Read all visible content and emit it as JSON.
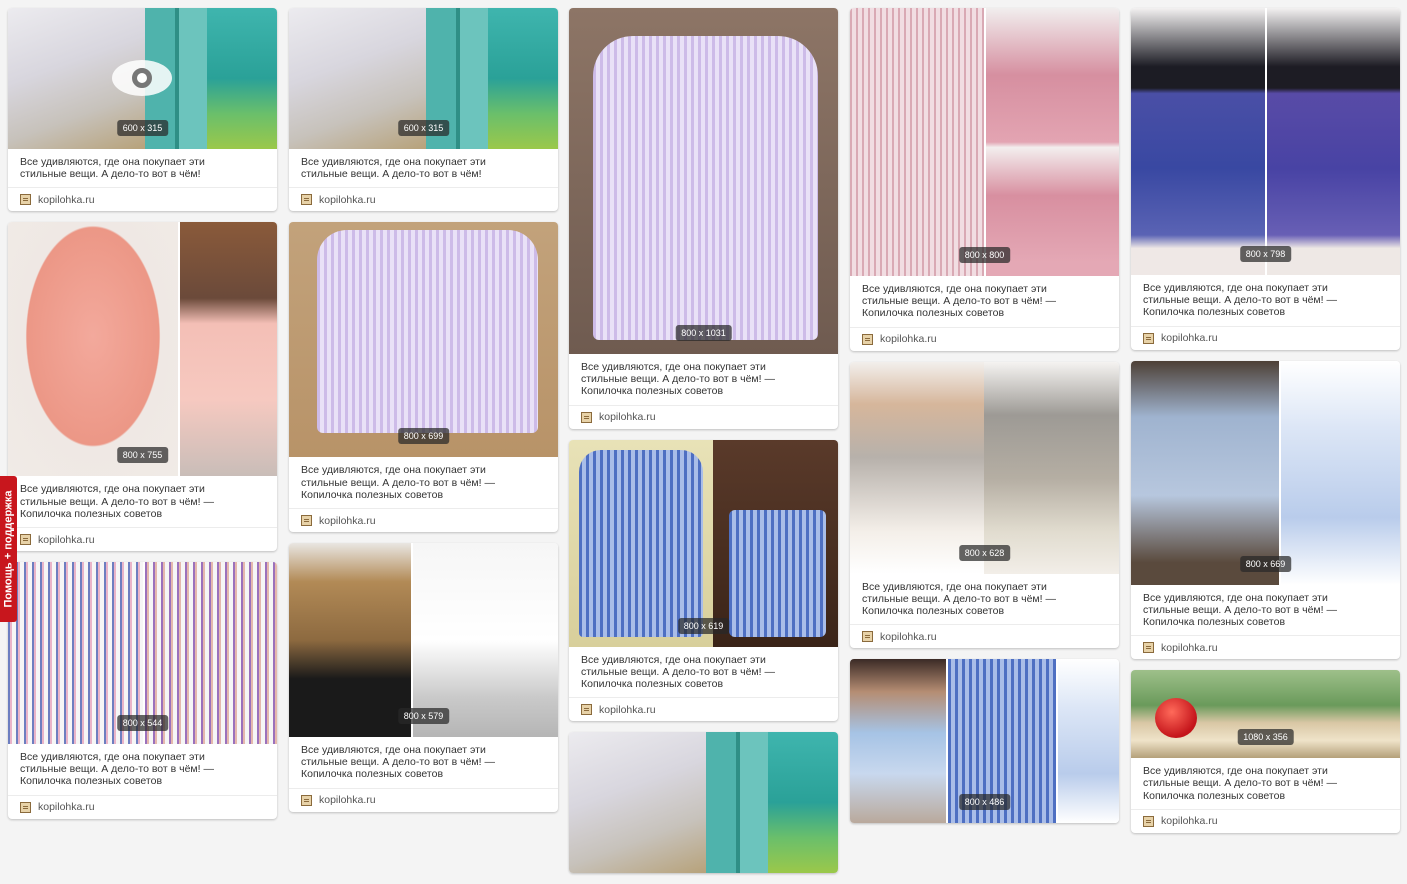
{
  "help_tab": {
    "label": "Помощь + поддержка"
  },
  "columns": [
    {
      "cards": [
        {
          "dims": "600 x 315",
          "desc": "Все удивляются, где она покупает эти\nстильные вещи. А дело-то вот в чём!",
          "source": "kopilohka.ru",
          "eye": true
        },
        {
          "dims": "800 x 755",
          "desc": "Все удивляются, где она покупает эти\nстильные вещи. А дело-то вот в чём! —\nКопилочка полезных советов",
          "source": "kopilohka.ru"
        },
        {
          "dims": "800 x 544",
          "desc": "Все удивляются, где она покупает эти\nстильные вещи. А дело-то вот в чём! —\nКопилочка полезных советов",
          "source": "kopilohka.ru"
        }
      ]
    },
    {
      "cards": [
        {
          "dims": "600 x 315",
          "desc": "Все удивляются, где она покупает эти\nстильные вещи. А дело-то вот в чём!",
          "source": "kopilohka.ru"
        },
        {
          "dims": "800 x 699",
          "desc": "Все удивляются, где она покупает эти\nстильные вещи. А дело-то вот в чём! —\nКопилочка полезных советов",
          "source": "kopilohka.ru"
        },
        {
          "dims": "800 x 579",
          "desc": "Все удивляются, где она покупает эти\nстильные вещи. А дело-то вот в чём! —\nКопилочка полезных советов",
          "source": "kopilohka.ru"
        }
      ]
    },
    {
      "cards": [
        {
          "dims": "800 x 1031",
          "desc": "Все удивляются, где она покупает эти\nстильные вещи. А дело-то вот в чём! —\nКопилочка полезных советов",
          "source": "kopilohka.ru"
        },
        {
          "dims": "800 x 619",
          "desc": "Все удивляются, где она покупает эти\nстильные вещи. А дело-то вот в чём! —\nКопилочка полезных советов",
          "source": "kopilohka.ru"
        },
        {
          "dims": "",
          "desc": "",
          "source": ""
        }
      ]
    },
    {
      "cards": [
        {
          "dims": "800 x 800",
          "desc": "Все удивляются, где она покупает эти\nстильные вещи. А дело-то вот в чём! —\nКопилочка полезных советов",
          "source": "kopilohka.ru"
        },
        {
          "dims": "800 x 628",
          "desc": "Все удивляются, где она покупает эти\nстильные вещи. А дело-то вот в чём! —\nКопилочка полезных советов",
          "source": "kopilohka.ru"
        },
        {
          "dims": "800 x 486",
          "desc": "",
          "source": ""
        }
      ]
    },
    {
      "cards": [
        {
          "dims": "800 x 798",
          "desc": "Все удивляются, где она покупает эти\nстильные вещи. А дело-то вот в чём! —\nКопилочка полезных советов",
          "source": "kopilohka.ru"
        },
        {
          "dims": "800 x 669",
          "desc": "Все удивляются, где она покупает эти\nстильные вещи. А дело-то вот в чём! —\nКопилочка полезных советов",
          "source": "kopilohka.ru"
        },
        {
          "dims": "1080 x 356",
          "desc": "Все удивляются, где она покупает эти\nстильные вещи. А дело-то вот в чём! —\nКопилочка полезных советов",
          "source": "kopilohka.ru"
        }
      ]
    }
  ]
}
